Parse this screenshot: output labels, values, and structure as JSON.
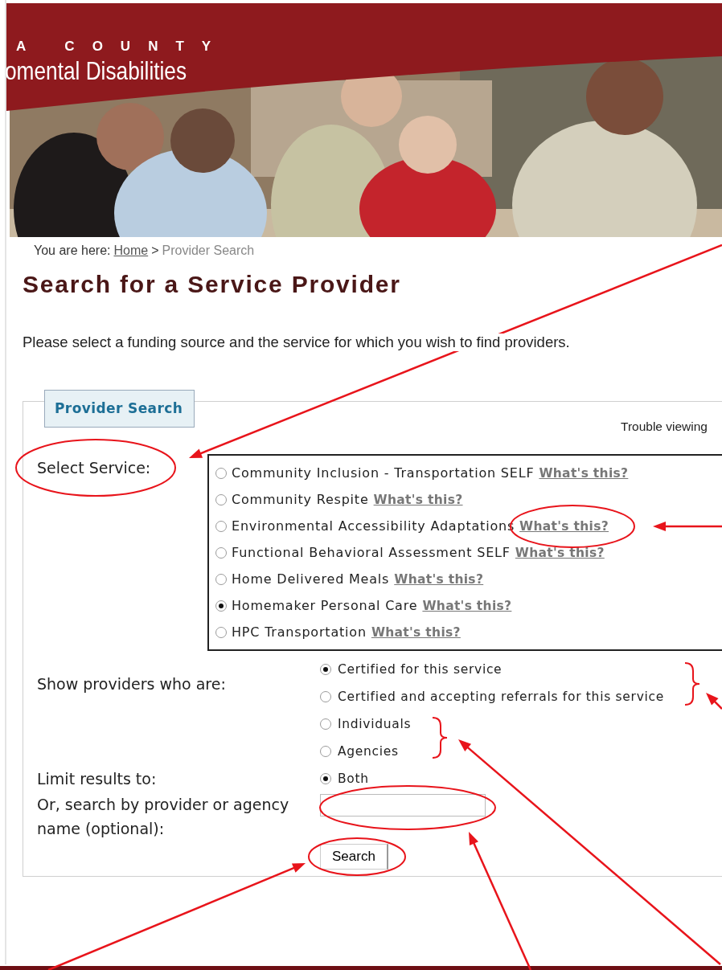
{
  "header": {
    "county_text": "A COUNTY",
    "org_text": "omental Disabilities"
  },
  "breadcrumb": {
    "label": "You are here:",
    "home": "Home",
    "separator": ">",
    "current": "Provider Search"
  },
  "title": "Search for a Service Provider",
  "intro": "Please select a funding source and the service for which you wish to find providers.",
  "form": {
    "legend": "Provider Search",
    "trouble_text": "Trouble viewing",
    "service_label": "Select Service:",
    "services": [
      {
        "label": "Community Inclusion - Transportation SELF",
        "help": "What's this?",
        "selected": false
      },
      {
        "label": "Community Respite",
        "help": "What's this?",
        "selected": false
      },
      {
        "label": "Environmental Accessibility Adaptations",
        "help": "What's this?",
        "selected": false
      },
      {
        "label": "Functional Behavioral Assessment SELF",
        "help": "What's this?",
        "selected": false
      },
      {
        "label": "Home Delivered Meals",
        "help": "What's this?",
        "selected": false
      },
      {
        "label": "Homemaker Personal Care",
        "help": "What's this?",
        "selected": true
      },
      {
        "label": "HPC Transportation",
        "help": "What's this?",
        "selected": false
      }
    ],
    "providers_label": "Show providers who are:",
    "provider_options": [
      {
        "label": "Certified for this service",
        "selected": true
      },
      {
        "label": "Certified and accepting referrals for this service",
        "selected": false
      }
    ],
    "limit_label": "Limit results to:",
    "limit_options": [
      {
        "label": "Individuals",
        "selected": false
      },
      {
        "label": "Agencies",
        "selected": false
      },
      {
        "label": "Both",
        "selected": true
      }
    ],
    "name_label": "Or, search by provider or agency name (optional):",
    "search_button": "Search"
  }
}
